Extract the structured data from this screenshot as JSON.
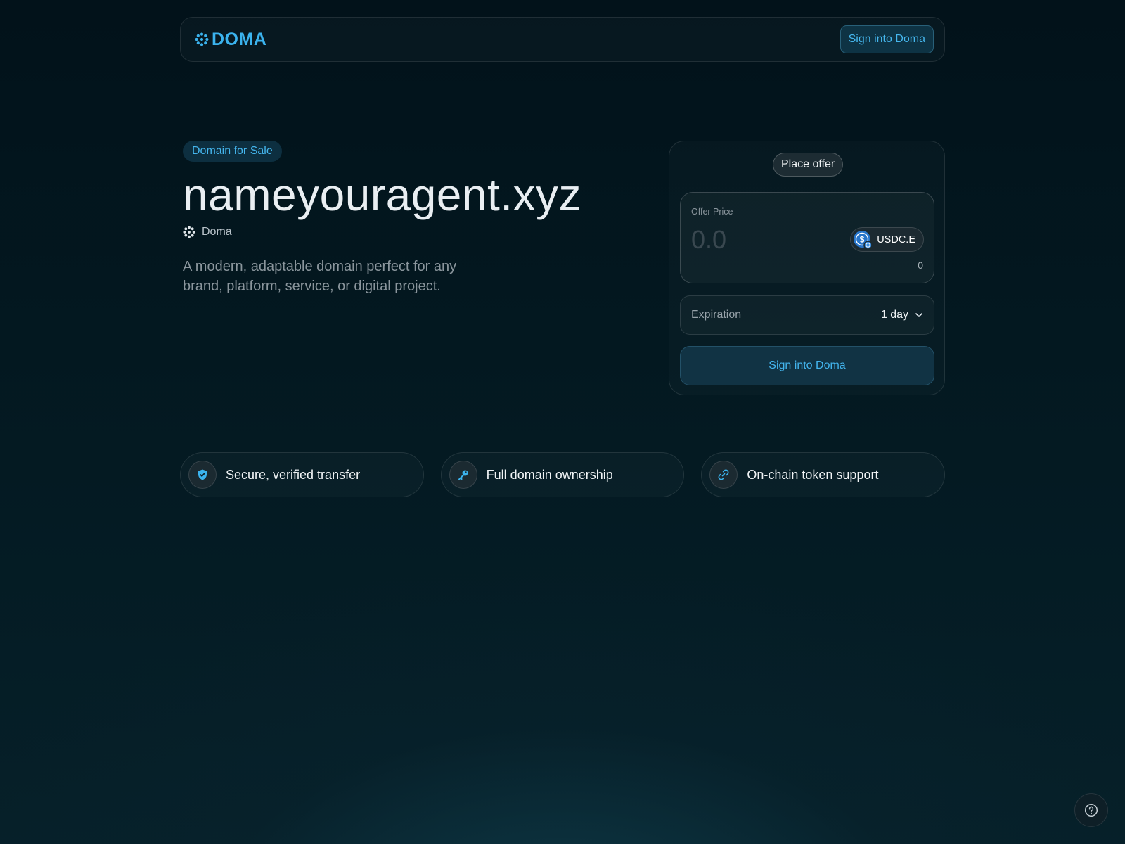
{
  "header": {
    "logo_text": "DOMA",
    "signin_label": "Sign into Doma"
  },
  "hero": {
    "badge": "Domain for Sale",
    "domain": "nameyouragent.xyz",
    "registrar": "Doma",
    "description": "A modern, adaptable domain perfect for any brand, platform, service, or digital project."
  },
  "offer_card": {
    "tab_label": "Place offer",
    "price_label": "Offer Price",
    "price_placeholder": "0.0",
    "token": "USDC.E",
    "balance": "0",
    "expiration_label": "Expiration",
    "expiration_value": "1 day",
    "signin_label": "Sign into Doma"
  },
  "features": [
    {
      "label": "Secure, verified transfer",
      "icon": "shield-check-icon"
    },
    {
      "label": "Full domain ownership",
      "icon": "key-icon"
    },
    {
      "label": "On-chain token support",
      "icon": "link-icon"
    }
  ],
  "colors": {
    "accent": "#3bb3ee",
    "background": "#02121a"
  },
  "help": {
    "icon": "help-icon"
  }
}
